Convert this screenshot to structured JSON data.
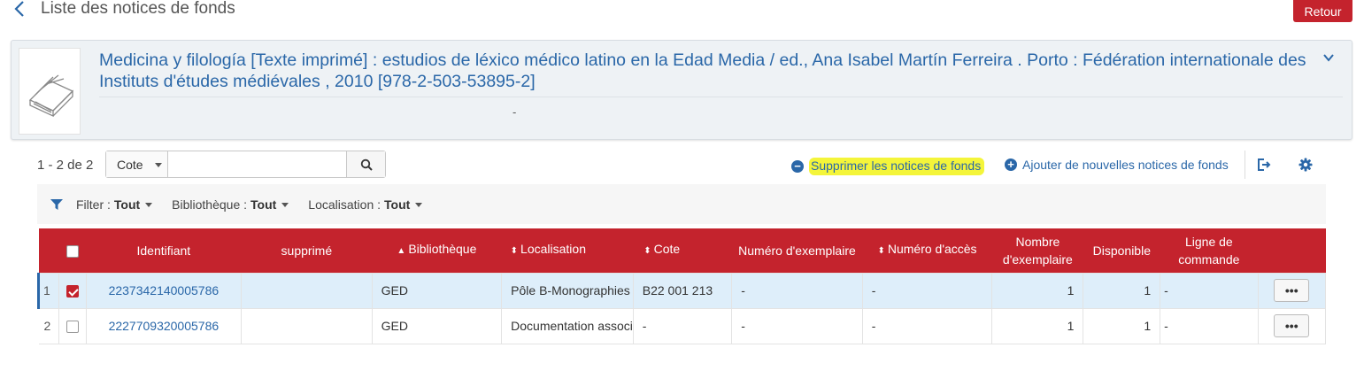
{
  "header": {
    "title": "Liste des notices de fonds",
    "back_icon": "chevron-left-icon",
    "retour_label": "Retour",
    "accent_color": "#c4232d"
  },
  "record": {
    "title": "Medicina y filología [Texte imprimé] : estudios de léxico médico latino en la Edad Media / ed., Ana Isabel Martín Ferreira . Porto : Fédération internationale des Instituts d'études médiévales , 2010 [978-2-503-53895-2]",
    "subline": "-",
    "thumbnail_icon": "book-icon",
    "expand_icon": "chevron-down-icon"
  },
  "toolbar": {
    "result_count": "1 - 2 de 2",
    "search_field_selected": "Cote",
    "search_value": "",
    "delete_label": "Supprimer les notices de fonds",
    "add_label": "Ajouter de nouvelles notices de fonds",
    "export_icon": "export-icon",
    "settings_icon": "gear-icon"
  },
  "filters": {
    "filter_label": "Filter :",
    "filter_value": "Tout",
    "library_label": "Bibliothèque :",
    "library_value": "Tout",
    "location_label": "Localisation :",
    "location_value": "Tout"
  },
  "table": {
    "headers": {
      "identifiant": "Identifiant",
      "supprime": "supprimé",
      "bibliotheque": "Bibliothèque",
      "localisation": "Localisation",
      "cote": "Cote",
      "numero_exemplaire": "Numéro d'exemplaire",
      "numero_acces": "Numéro d'accès",
      "nombre_exemplaire": "Nombre d'exemplaire",
      "disponible": "Disponible",
      "ligne_commande": "Ligne de commande"
    },
    "rows": [
      {
        "num": "1",
        "selected": true,
        "identifiant": "2237342140005786",
        "supprime": "",
        "bibliotheque": "GED",
        "localisation": "Pôle B-Monographies",
        "cote": "B22 001 213",
        "numero_exemplaire": "-",
        "numero_acces": "-",
        "nombre_exemplaire": "1",
        "disponible": "1",
        "ligne_commande": "-",
        "more": "•••"
      },
      {
        "num": "2",
        "selected": false,
        "identifiant": "2227709320005786",
        "supprime": "",
        "bibliotheque": "GED",
        "localisation": "Documentation associée IRHT",
        "cote": "-",
        "numero_exemplaire": "-",
        "numero_acces": "-",
        "nombre_exemplaire": "1",
        "disponible": "1",
        "ligne_commande": "-",
        "more": "•••"
      }
    ]
  }
}
